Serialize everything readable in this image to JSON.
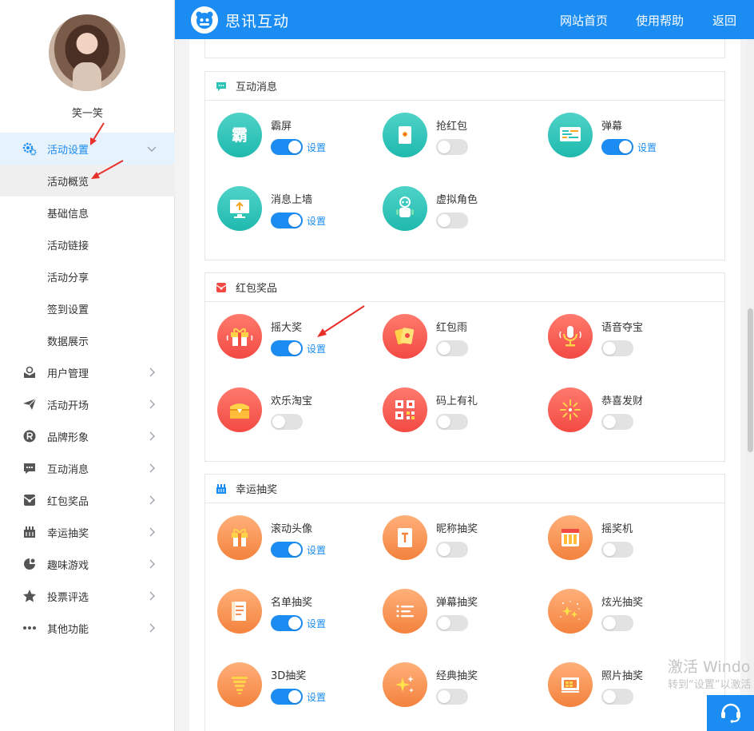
{
  "app": {
    "brand": "思讯互动",
    "accent": "#1b8cf1"
  },
  "header": {
    "nav": [
      {
        "label": "网站首页"
      },
      {
        "label": "使用帮助"
      },
      {
        "label": "返回"
      }
    ]
  },
  "user": {
    "name": "笑一笑"
  },
  "sidebar": {
    "active": {
      "label": "活动设置",
      "icon": "gear-icon"
    },
    "subitems": [
      {
        "label": "活动概览"
      },
      {
        "label": "基础信息"
      },
      {
        "label": "活动链接"
      },
      {
        "label": "活动分享"
      },
      {
        "label": "签到设置"
      },
      {
        "label": "数据展示"
      }
    ],
    "items": [
      {
        "label": "用户管理",
        "icon": "user-icon"
      },
      {
        "label": "活动开场",
        "icon": "paper-plane-icon"
      },
      {
        "label": "品牌形象",
        "icon": "registered-icon"
      },
      {
        "label": "互动消息",
        "icon": "chat-icon"
      },
      {
        "label": "红包奖品",
        "icon": "red-envelope-icon"
      },
      {
        "label": "幸运抽奖",
        "icon": "lottery-icon"
      },
      {
        "label": "趣味游戏",
        "icon": "game-icon"
      },
      {
        "label": "投票评选",
        "icon": "star-icon"
      },
      {
        "label": "其他功能",
        "icon": "more-icon"
      }
    ]
  },
  "sections": {
    "interactive": {
      "title": "互动消息",
      "items": [
        {
          "name": "霸屏",
          "icon": "bapping-icon",
          "enabled": true,
          "setting": "设置"
        },
        {
          "name": "抢红包",
          "icon": "red-envelope-icon",
          "enabled": false
        },
        {
          "name": "弹幕",
          "icon": "danmaku-icon",
          "enabled": true,
          "setting": "设置"
        },
        {
          "name": "消息上墙",
          "icon": "message-wall-icon",
          "enabled": true,
          "setting": "设置"
        },
        {
          "name": "虚拟角色",
          "icon": "robot-icon",
          "enabled": false
        }
      ]
    },
    "redpacket": {
      "title": "红包奖品",
      "items": [
        {
          "name": "摇大奖",
          "icon": "gift-icon",
          "enabled": true,
          "setting": "设置"
        },
        {
          "name": "红包雨",
          "icon": "red-envelope-rain-icon",
          "enabled": false
        },
        {
          "name": "语音夺宝",
          "icon": "microphone-icon",
          "enabled": false
        },
        {
          "name": "欢乐淘宝",
          "icon": "treasure-chest-icon",
          "enabled": false
        },
        {
          "name": "码上有礼",
          "icon": "qr-code-icon",
          "enabled": false
        },
        {
          "name": "恭喜发财",
          "icon": "firework-icon",
          "enabled": false
        }
      ]
    },
    "lottery": {
      "title": "幸运抽奖",
      "items": [
        {
          "name": "滚动头像",
          "icon": "gift-box-icon",
          "enabled": true,
          "setting": "设置"
        },
        {
          "name": "昵称抽奖",
          "icon": "nickname-card-icon",
          "enabled": false
        },
        {
          "name": "摇奖机",
          "icon": "slot-machine-icon",
          "enabled": false
        },
        {
          "name": "名单抽奖",
          "icon": "list-icon",
          "enabled": true,
          "setting": "设置"
        },
        {
          "name": "弹幕抽奖",
          "icon": "danmaku-lines-icon",
          "enabled": false
        },
        {
          "name": "炫光抽奖",
          "icon": "sparkle-stars-icon",
          "enabled": false
        },
        {
          "name": "3D抽奖",
          "icon": "stack-3d-icon",
          "enabled": true,
          "setting": "设置"
        },
        {
          "name": "经典抽奖",
          "icon": "sparkle-icon",
          "enabled": false
        },
        {
          "name": "照片抽奖",
          "icon": "photo-icon",
          "enabled": false
        }
      ]
    }
  },
  "watermark": {
    "line1": "激活 Windo",
    "line2": "转到“设置”以激活"
  }
}
